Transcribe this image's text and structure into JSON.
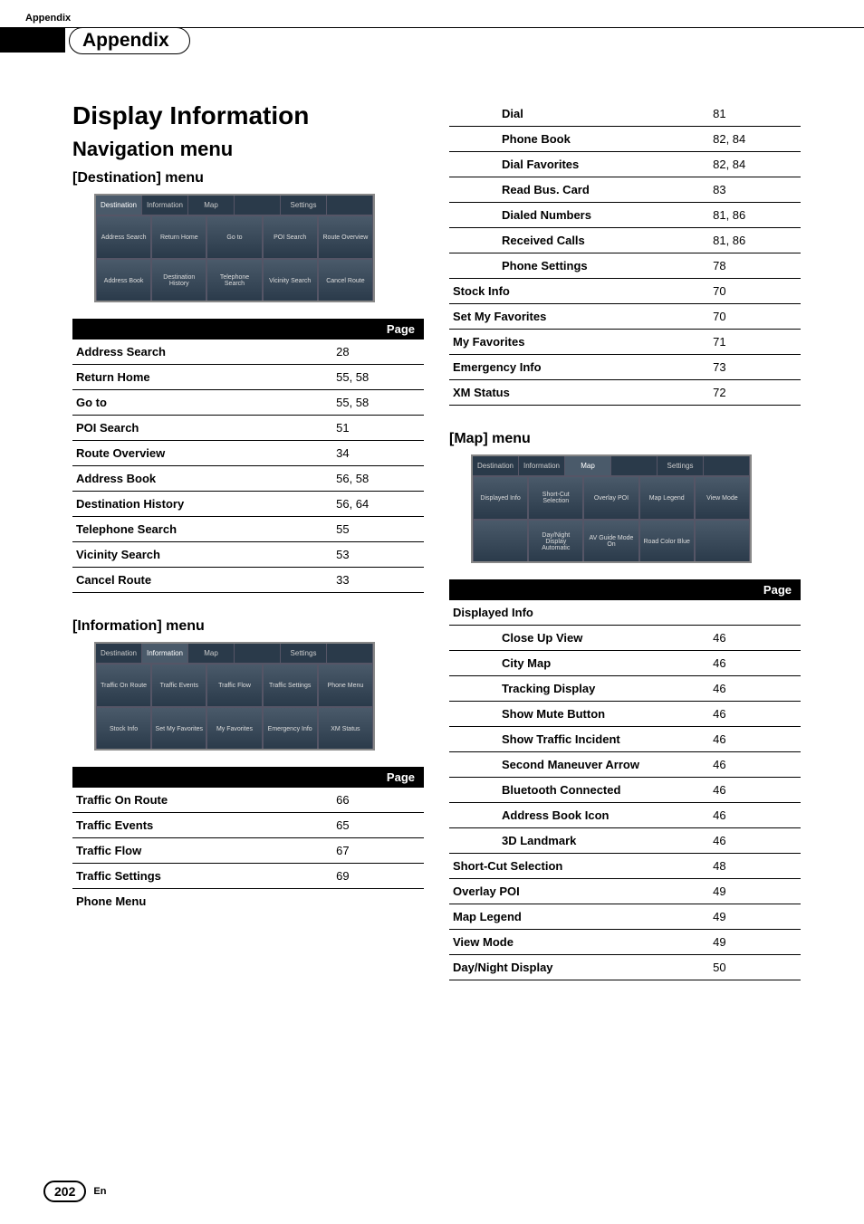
{
  "header": {
    "top_label": "Appendix",
    "section_title": "Appendix"
  },
  "titles": {
    "display_information": "Display Information",
    "navigation_menu": "Navigation menu",
    "destination_menu": "[Destination] menu",
    "information_menu": "[Information] menu",
    "map_menu": "[Map] menu"
  },
  "page_header_label": "Page",
  "screenshots": {
    "destination": {
      "tabs": [
        "Destination",
        "Information",
        "Map",
        "",
        "Settings",
        ""
      ],
      "cells": [
        "Address Search",
        "Return Home",
        "Go to",
        "POI Search",
        "Route Overview",
        "Address Book",
        "Destination History",
        "Telephone Search",
        "Vicinity Search",
        "Cancel Route"
      ]
    },
    "information": {
      "tabs": [
        "Destination",
        "Information",
        "Map",
        "",
        "Settings",
        ""
      ],
      "cells": [
        "Traffic On Route",
        "Traffic Events",
        "Traffic Flow",
        "Traffic Settings",
        "Phone Menu",
        "Stock Info",
        "Set My Favorites",
        "My Favorites",
        "Emergency Info",
        "XM Status"
      ]
    },
    "map": {
      "tabs": [
        "Destination",
        "Information",
        "Map",
        "",
        "Settings",
        ""
      ],
      "cells": [
        "Displayed Info",
        "Short-Cut Selection",
        "Overlay POI",
        "Map Legend",
        "View Mode",
        "",
        "Day/Night Display Automatic",
        "AV Guide Mode On",
        "Road Color Blue",
        ""
      ]
    }
  },
  "tables": {
    "destination": [
      {
        "label": "Address Search",
        "page": "28"
      },
      {
        "label": "Return Home",
        "page": "55, 58"
      },
      {
        "label": "Go to",
        "page": "55, 58"
      },
      {
        "label": "POI Search",
        "page": "51"
      },
      {
        "label": "Route Overview",
        "page": "34"
      },
      {
        "label": "Address Book",
        "page": "56, 58"
      },
      {
        "label": "Destination History",
        "page": "56, 64"
      },
      {
        "label": "Telephone Search",
        "page": "55"
      },
      {
        "label": "Vicinity Search",
        "page": "53"
      },
      {
        "label": "Cancel Route",
        "page": "33"
      }
    ],
    "information_left": [
      {
        "label": "Traffic On Route",
        "page": "66"
      },
      {
        "label": "Traffic Events",
        "page": "65"
      },
      {
        "label": "Traffic Flow",
        "page": "67"
      },
      {
        "label": "Traffic Settings",
        "page": "69"
      },
      {
        "label": "Phone Menu",
        "page": ""
      }
    ],
    "information_right": [
      {
        "label": "Dial",
        "page": "81",
        "indent": true
      },
      {
        "label": "Phone Book",
        "page": "82, 84",
        "indent": true
      },
      {
        "label": "Dial Favorites",
        "page": "82, 84",
        "indent": true
      },
      {
        "label": "Read Bus. Card",
        "page": "83",
        "indent": true
      },
      {
        "label": "Dialed Numbers",
        "page": "81, 86",
        "indent": true
      },
      {
        "label": "Received Calls",
        "page": "81, 86",
        "indent": true
      },
      {
        "label": "Phone Settings",
        "page": "78",
        "indent": true
      },
      {
        "label": "Stock Info",
        "page": "70"
      },
      {
        "label": "Set My Favorites",
        "page": "70"
      },
      {
        "label": "My Favorites",
        "page": "71"
      },
      {
        "label": "Emergency Info",
        "page": "73"
      },
      {
        "label": "XM Status",
        "page": "72"
      }
    ],
    "map": [
      {
        "label": "Displayed Info",
        "page": ""
      },
      {
        "label": "Close Up View",
        "page": "46",
        "indent": true
      },
      {
        "label": "City Map",
        "page": "46",
        "indent": true
      },
      {
        "label": "Tracking Display",
        "page": "46",
        "indent": true
      },
      {
        "label": "Show Mute Button",
        "page": "46",
        "indent": true
      },
      {
        "label": "Show Traffic Incident",
        "page": "46",
        "indent": true
      },
      {
        "label": "Second Maneuver Arrow",
        "page": "46",
        "indent": true
      },
      {
        "label": "Bluetooth Connected",
        "page": "46",
        "indent": true
      },
      {
        "label": "Address Book Icon",
        "page": "46",
        "indent": true
      },
      {
        "label": "3D Landmark",
        "page": "46",
        "indent": true
      },
      {
        "label": "Short-Cut Selection",
        "page": "48"
      },
      {
        "label": "Overlay POI",
        "page": "49"
      },
      {
        "label": "Map Legend",
        "page": "49"
      },
      {
        "label": "View Mode",
        "page": "49"
      },
      {
        "label": "Day/Night Display",
        "page": "50"
      }
    ]
  },
  "footer": {
    "page_number": "202",
    "lang": "En"
  }
}
